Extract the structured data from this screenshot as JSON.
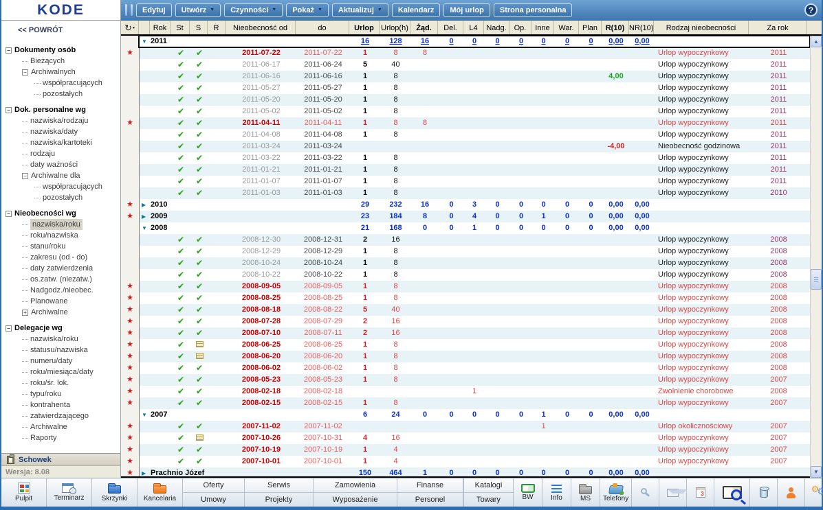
{
  "app": {
    "logo": "KODE",
    "help_label": "?"
  },
  "toolbar": {
    "buttons": [
      {
        "label": "Edytuj",
        "dropdown": false
      },
      {
        "label": "Utwórz",
        "dropdown": true
      },
      {
        "label": "Czynności",
        "dropdown": true
      },
      {
        "label": "Pokaż",
        "dropdown": true
      },
      {
        "label": "Aktualizuj",
        "dropdown": true
      },
      {
        "label": "Kalendarz",
        "dropdown": false
      },
      {
        "label": "Mój urlop",
        "dropdown": false
      },
      {
        "label": "Strona personalna",
        "dropdown": false
      }
    ]
  },
  "sidebar": {
    "back": "<< POWRÓT",
    "tree": [
      {
        "label": "Dokumenty osób",
        "level": 0,
        "section": true,
        "box": "minus"
      },
      {
        "label": "Bieżących",
        "level": 1
      },
      {
        "label": "Archiwalnych",
        "level": 1,
        "box": "minus"
      },
      {
        "label": "współpracujących",
        "level": 2
      },
      {
        "label": "pozostałych",
        "level": 2
      },
      {
        "label": "Dok. personalne wg",
        "level": 0,
        "section": true,
        "box": "minus"
      },
      {
        "label": "nazwiska/rodzaju",
        "level": 1
      },
      {
        "label": "nazwiska/daty",
        "level": 1
      },
      {
        "label": "nazwiska/kartoteki",
        "level": 1
      },
      {
        "label": "rodzaju",
        "level": 1
      },
      {
        "label": "daty ważności",
        "level": 1
      },
      {
        "label": "Archiwalne dla",
        "level": 1,
        "box": "minus"
      },
      {
        "label": "współpracujących",
        "level": 2
      },
      {
        "label": "pozostałych",
        "level": 2
      },
      {
        "label": "Nieobecności wg",
        "level": 0,
        "section": true,
        "box": "minus"
      },
      {
        "label": "nazwiska/roku",
        "level": 1,
        "selected": true
      },
      {
        "label": "roku/nazwiska",
        "level": 1
      },
      {
        "label": "stanu/roku",
        "level": 1
      },
      {
        "label": "zakresu (od - do)",
        "level": 1
      },
      {
        "label": "daty zatwierdzenia",
        "level": 1
      },
      {
        "label": "os.zatw. (niezatw.)",
        "level": 1
      },
      {
        "label": "Nadgodz./nieobec.",
        "level": 1
      },
      {
        "label": "Planowane",
        "level": 1
      },
      {
        "label": "Archiwalne",
        "level": 1,
        "box": "plus"
      },
      {
        "label": "Delegacje wg",
        "level": 0,
        "section": true,
        "box": "minus"
      },
      {
        "label": "nazwiska/roku",
        "level": 1
      },
      {
        "label": "statusu/nazwiska",
        "level": 1
      },
      {
        "label": "numeru/daty",
        "level": 1
      },
      {
        "label": "roku/miesiąca/daty",
        "level": 1
      },
      {
        "label": "roku/śr. lok.",
        "level": 1
      },
      {
        "label": "typu/roku",
        "level": 1
      },
      {
        "label": "kontrahenta",
        "level": 1
      },
      {
        "label": "zatwierdzającego",
        "level": 1
      },
      {
        "label": "Archiwalne",
        "level": 1
      },
      {
        "label": "Raporty",
        "level": 1
      }
    ],
    "schowek": "Schowek",
    "version": "Wersja: 8.08"
  },
  "table": {
    "columns": [
      "Rok",
      "St",
      "S",
      "R",
      "Nieobecność od",
      "do",
      "Urlop",
      "Urlop(h)",
      "Żąd.",
      "Del.",
      "L4",
      "Nadg.",
      "Op.",
      "Inne",
      "War.",
      "Plan",
      "R(10)",
      "NR(10)",
      "Rodzaj nieobecności",
      "Za rok"
    ],
    "rows": [
      {
        "type": "group",
        "label": "2011",
        "expanded": true,
        "selected": true,
        "star": false,
        "urlop": "16",
        "urloph": "128",
        "zad": "16",
        "del": "0",
        "l4": "0",
        "nadg": "0",
        "op": "0",
        "inne": "0",
        "war": "0",
        "plan": "0",
        "r10": "0,00",
        "nr10": "0,00"
      },
      {
        "type": "data",
        "star": true,
        "red": true,
        "st": "check",
        "s": "check",
        "od": "2011-07-22",
        "do": "2011-07-22",
        "urlop": "1",
        "urloph": "8",
        "zad": "8",
        "rodzaj": "Urlop wypoczynkowy",
        "zarok": "2011"
      },
      {
        "type": "data",
        "star": false,
        "red": false,
        "st": "check",
        "s": "check",
        "od": "2011-06-17",
        "do": "2011-06-24",
        "urlop": "5",
        "urloph": "40",
        "rodzaj": "Urlop wypoczynkowy",
        "zarok": "2011"
      },
      {
        "type": "data",
        "star": false,
        "red": false,
        "st": "check",
        "s": "check",
        "od": "2011-06-16",
        "do": "2011-06-16",
        "urlop": "1",
        "urloph": "8",
        "r10": "4,00",
        "r10c": "green",
        "rodzaj": "Urlop wypoczynkowy",
        "zarok": "2011"
      },
      {
        "type": "data",
        "star": false,
        "red": false,
        "st": "check",
        "s": "check",
        "od": "2011-05-27",
        "do": "2011-05-27",
        "urlop": "1",
        "urloph": "8",
        "rodzaj": "Urlop wypoczynkowy",
        "zarok": "2011"
      },
      {
        "type": "data",
        "star": false,
        "red": false,
        "st": "check",
        "s": "check",
        "od": "2011-05-20",
        "do": "2011-05-20",
        "urlop": "1",
        "urloph": "8",
        "rodzaj": "Urlop wypoczynkowy",
        "zarok": "2011"
      },
      {
        "type": "data",
        "star": false,
        "red": false,
        "st": "check",
        "s": "check",
        "od": "2011-05-02",
        "do": "2011-05-02",
        "urlop": "1",
        "urloph": "8",
        "rodzaj": "Urlop wypoczynkowy",
        "zarok": "2011"
      },
      {
        "type": "data",
        "star": true,
        "red": true,
        "st": "check",
        "s": "check",
        "od": "2011-04-11",
        "do": "2011-04-11",
        "urlop": "1",
        "urloph": "8",
        "zad": "8",
        "rodzaj": "Urlop wypoczynkowy",
        "zarok": "2011"
      },
      {
        "type": "data",
        "star": false,
        "red": false,
        "st": "check",
        "s": "check",
        "od": "2011-04-08",
        "do": "2011-04-08",
        "urlop": "1",
        "urloph": "8",
        "rodzaj": "Urlop wypoczynkowy",
        "zarok": "2011"
      },
      {
        "type": "data",
        "star": false,
        "red": false,
        "st": "check",
        "s": "check",
        "od": "2011-03-24",
        "do": "2011-03-24",
        "r10": "-4,00",
        "r10c": "red",
        "rodzaj": "Nieobecność godzinowa",
        "zarok": "2011"
      },
      {
        "type": "data",
        "star": false,
        "red": false,
        "st": "check",
        "s": "check",
        "od": "2011-03-22",
        "do": "2011-03-22",
        "urlop": "1",
        "urloph": "8",
        "rodzaj": "Urlop wypoczynkowy",
        "zarok": "2011"
      },
      {
        "type": "data",
        "star": false,
        "red": false,
        "st": "check",
        "s": "check",
        "od": "2011-01-21",
        "do": "2011-01-21",
        "urlop": "1",
        "urloph": "8",
        "rodzaj": "Urlop wypoczynkowy",
        "zarok": "2011"
      },
      {
        "type": "data",
        "star": false,
        "red": false,
        "st": "check",
        "s": "check",
        "od": "2011-01-07",
        "do": "2011-01-07",
        "urlop": "1",
        "urloph": "8",
        "rodzaj": "Urlop wypoczynkowy",
        "zarok": "2011"
      },
      {
        "type": "data",
        "star": false,
        "red": false,
        "st": "check",
        "s": "check",
        "od": "2011-01-03",
        "do": "2011-01-03",
        "urlop": "1",
        "urloph": "8",
        "rodzaj": "Urlop wypoczynkowy",
        "zarok": "2010"
      },
      {
        "type": "group",
        "label": "2010",
        "expanded": false,
        "star": true,
        "urlop": "29",
        "urloph": "232",
        "zad": "16",
        "del": "0",
        "l4": "3",
        "nadg": "0",
        "op": "0",
        "inne": "0",
        "war": "0",
        "plan": "0",
        "r10": "0,00",
        "nr10": "0,00"
      },
      {
        "type": "group",
        "label": "2009",
        "expanded": false,
        "star": true,
        "urlop": "23",
        "urloph": "184",
        "zad": "8",
        "del": "0",
        "l4": "4",
        "nadg": "0",
        "op": "0",
        "inne": "1",
        "war": "0",
        "plan": "0",
        "r10": "0,00",
        "nr10": "0,00"
      },
      {
        "type": "group",
        "label": "2008",
        "expanded": true,
        "star": false,
        "urlop": "21",
        "urloph": "168",
        "zad": "0",
        "del": "0",
        "l4": "1",
        "nadg": "0",
        "op": "0",
        "inne": "0",
        "war": "0",
        "plan": "0",
        "r10": "0,00",
        "nr10": "0,00"
      },
      {
        "type": "data",
        "star": false,
        "red": false,
        "st": "check",
        "s": "check",
        "od": "2008-12-30",
        "do": "2008-12-31",
        "urlop": "2",
        "urloph": "16",
        "rodzaj": "Urlop wypoczynkowy",
        "zarok": "2008"
      },
      {
        "type": "data",
        "star": false,
        "red": false,
        "st": "check",
        "s": "check",
        "od": "2008-12-29",
        "do": "2008-12-29",
        "urlop": "1",
        "urloph": "8",
        "rodzaj": "Urlop wypoczynkowy",
        "zarok": "2008"
      },
      {
        "type": "data",
        "star": false,
        "red": false,
        "st": "check",
        "s": "check",
        "od": "2008-10-24",
        "do": "2008-10-24",
        "urlop": "1",
        "urloph": "8",
        "rodzaj": "Urlop wypoczynkowy",
        "zarok": "2008"
      },
      {
        "type": "data",
        "star": false,
        "red": false,
        "st": "check",
        "s": "check",
        "od": "2008-10-22",
        "do": "2008-10-22",
        "urlop": "1",
        "urloph": "8",
        "rodzaj": "Urlop wypoczynkowy",
        "zarok": "2008"
      },
      {
        "type": "data",
        "star": true,
        "red": true,
        "st": "check",
        "s": "check",
        "od": "2008-09-05",
        "do": "2008-09-05",
        "urlop": "1",
        "urloph": "8",
        "rodzaj": "Urlop wypoczynkowy",
        "zarok": "2008"
      },
      {
        "type": "data",
        "star": true,
        "red": true,
        "st": "check",
        "s": "check",
        "od": "2008-08-25",
        "do": "2008-08-25",
        "urlop": "1",
        "urloph": "8",
        "rodzaj": "Urlop wypoczynkowy",
        "zarok": "2008"
      },
      {
        "type": "data",
        "star": true,
        "red": true,
        "st": "check",
        "s": "check",
        "od": "2008-08-18",
        "do": "2008-08-22",
        "urlop": "5",
        "urloph": "40",
        "rodzaj": "Urlop wypoczynkowy",
        "zarok": "2008"
      },
      {
        "type": "data",
        "star": true,
        "red": true,
        "st": "check",
        "s": "check",
        "od": "2008-07-28",
        "do": "2008-07-29",
        "urlop": "2",
        "urloph": "16",
        "rodzaj": "Urlop wypoczynkowy",
        "zarok": "2008"
      },
      {
        "type": "data",
        "star": true,
        "red": true,
        "st": "check",
        "s": "check",
        "od": "2008-07-10",
        "do": "2008-07-11",
        "urlop": "2",
        "urloph": "16",
        "rodzaj": "Urlop wypoczynkowy",
        "zarok": "2008"
      },
      {
        "type": "data",
        "star": true,
        "red": true,
        "st": "check",
        "s": "note",
        "od": "2008-06-25",
        "do": "2008-06-25",
        "urlop": "1",
        "urloph": "8",
        "rodzaj": "Urlop wypoczynkowy",
        "zarok": "2008"
      },
      {
        "type": "data",
        "star": true,
        "red": true,
        "st": "check",
        "s": "note",
        "od": "2008-06-20",
        "do": "2008-06-20",
        "urlop": "1",
        "urloph": "8",
        "rodzaj": "Urlop wypoczynkowy",
        "zarok": "2008"
      },
      {
        "type": "data",
        "star": true,
        "red": true,
        "st": "check",
        "s": "check",
        "od": "2008-06-02",
        "do": "2008-06-02",
        "urlop": "1",
        "urloph": "8",
        "rodzaj": "Urlop wypoczynkowy",
        "zarok": "2008"
      },
      {
        "type": "data",
        "star": true,
        "red": true,
        "st": "check",
        "s": "check",
        "od": "2008-05-23",
        "do": "2008-05-23",
        "urlop": "1",
        "urloph": "8",
        "rodzaj": "Urlop wypoczynkowy",
        "zarok": "2007"
      },
      {
        "type": "data",
        "star": true,
        "red": true,
        "st": "check",
        "s": "check",
        "od": "2008-02-18",
        "do": "2008-02-18",
        "l4": "1",
        "rodzaj": "Zwolnienie chorobowe",
        "zarok": "2008"
      },
      {
        "type": "data",
        "star": true,
        "red": true,
        "st": "check",
        "s": "check",
        "od": "2008-02-15",
        "do": "2008-02-15",
        "urlop": "1",
        "urloph": "8",
        "rodzaj": "Urlop wypoczynkowy",
        "zarok": "2007"
      },
      {
        "type": "group",
        "label": "2007",
        "expanded": true,
        "star": false,
        "urlop": "6",
        "urloph": "24",
        "zad": "0",
        "del": "0",
        "l4": "0",
        "nadg": "0",
        "op": "0",
        "inne": "1",
        "war": "0",
        "plan": "0",
        "r10": "0,00",
        "nr10": "0,00"
      },
      {
        "type": "data",
        "star": true,
        "red": true,
        "st": "check",
        "s": "check",
        "od": "2007-11-02",
        "do": "2007-11-02",
        "inne": "1",
        "rodzaj": "Urlop okolicznościowy",
        "zarok": "2007"
      },
      {
        "type": "data",
        "star": true,
        "red": true,
        "st": "check",
        "s": "note",
        "od": "2007-10-26",
        "do": "2007-10-31",
        "urlop": "4",
        "urloph": "16",
        "rodzaj": "Urlop wypoczynkowy",
        "zarok": "2007"
      },
      {
        "type": "data",
        "star": true,
        "red": true,
        "st": "check",
        "s": "check",
        "od": "2007-10-19",
        "do": "2007-10-19",
        "urlop": "1",
        "urloph": "4",
        "rodzaj": "Urlop wypoczynkowy",
        "zarok": "2007"
      },
      {
        "type": "data",
        "star": true,
        "red": true,
        "st": "check",
        "s": "check",
        "od": "2007-10-01",
        "do": "2007-10-01",
        "urlop": "1",
        "urloph": "4",
        "rodzaj": "Urlop wypoczynkowy",
        "zarok": "2007"
      },
      {
        "type": "group",
        "label": "Prachnio Józef",
        "expanded": false,
        "star": true,
        "urlop": "150",
        "urloph": "464",
        "zad": "1",
        "del": "0",
        "l4": "0",
        "nadg": "0",
        "op": "0",
        "inne": "0",
        "war": "0",
        "plan": "0",
        "r10": "0,00",
        "nr10": "0,00"
      }
    ]
  },
  "bottombar": {
    "apps": [
      {
        "label": "Pulpit",
        "icon": "desktop-grid-icon"
      },
      {
        "label": "Terminarz",
        "icon": "calendar-clock-icon"
      },
      {
        "label": "Skrzynki",
        "icon": "blue-folder-icon"
      },
      {
        "label": "Kancelaria",
        "icon": "orange-folder-icon"
      }
    ],
    "menu": [
      [
        "Oferty",
        "Serwis",
        "Zamowienia",
        "Finanse"
      ],
      [
        "Umowy",
        "Projekty",
        "Wyposażenie",
        "Personel"
      ]
    ],
    "right_menu": [
      "Katalogi",
      "Towary"
    ],
    "modules": [
      {
        "label": "BW",
        "icon": "green-book-icon"
      },
      {
        "label": "Info",
        "icon": "info-list-icon"
      },
      {
        "label": "MS",
        "icon": "gray-folder-icon"
      },
      {
        "label": "Telefony",
        "icon": "phone-icon"
      }
    ],
    "trailing_icons": [
      "search-icon",
      "mail-icon",
      "calendar-icon",
      "lookup-book-icon",
      "bin-icon",
      "user-icon",
      "settings-gears-icon"
    ]
  }
}
